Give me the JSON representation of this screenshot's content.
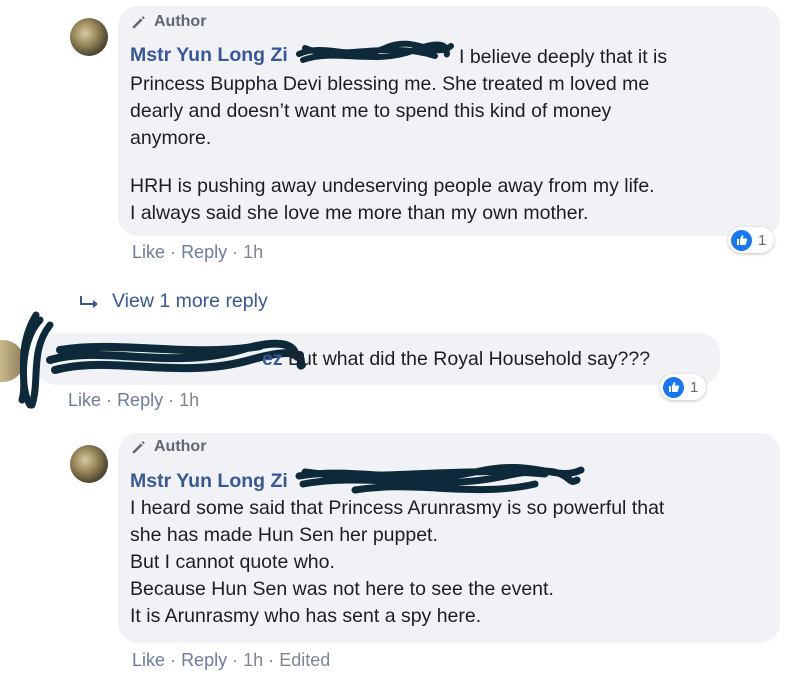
{
  "comments": [
    {
      "author_badge": "Author",
      "name": "Mstr Yun Long Zi",
      "paragraphs": [
        [
          "I believe deeply that it is",
          "Princess Buppha Devi blessing me. She treated m loved me",
          "dearly and doesn’t want me to spend this kind of money",
          "anymore."
        ],
        [
          "HRH is pushing away undeserving people away from my life.",
          "I always said she love me more than my own mother."
        ]
      ],
      "actions": {
        "like": "Like",
        "reply": "Reply",
        "time": "1h"
      },
      "reaction_count": "1"
    },
    {
      "view_more": "View 1 more reply"
    },
    {
      "name_fragment": "ez",
      "text": "But what did the Royal Household say???",
      "actions": {
        "like": "Like",
        "reply": "Reply",
        "time": "1h"
      },
      "reaction_count": "1"
    },
    {
      "author_badge": "Author",
      "name": "Mstr Yun Long Zi",
      "lines": [
        "I heard some said that Princess Arunrasmy is so powerful that",
        "she has made Hun Sen her puppet.",
        "But I cannot quote who.",
        "Because Hun Sen was not here to see the event.",
        "It is Arunrasmy who has sent a spy here."
      ],
      "actions": {
        "like": "Like",
        "reply": "Reply",
        "time": "1h",
        "edited": "Edited"
      }
    }
  ],
  "separator": "·",
  "colors": {
    "bubble": "#f0f2f5",
    "name": "#385898",
    "like_blue": "#1877f2",
    "meta": "#7f8691",
    "scribble": "#0e2a3a"
  },
  "icons": [
    "pencil-icon",
    "reply-arrow-icon",
    "like-thumb-icon"
  ]
}
